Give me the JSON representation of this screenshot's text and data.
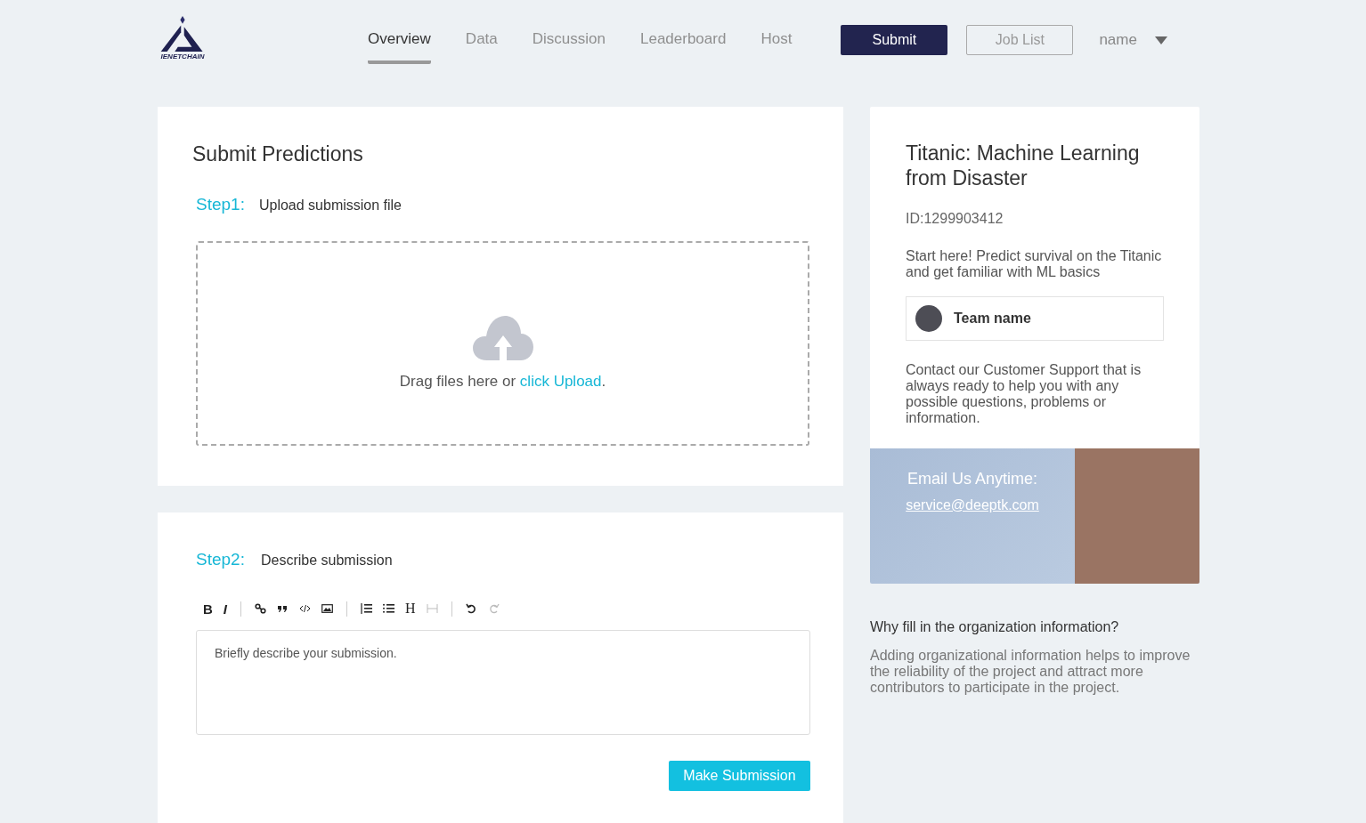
{
  "logo": {
    "text": "IENETCHAIN"
  },
  "tabs": [
    {
      "label": "Overview",
      "selected": true
    },
    {
      "label": "Data",
      "selected": false
    },
    {
      "label": "Discussion",
      "selected": false
    },
    {
      "label": "Leaderboard",
      "selected": false
    },
    {
      "label": "Host",
      "selected": false
    }
  ],
  "header_buttons": {
    "submit": "Submit",
    "job_list": "Job List",
    "user": "name"
  },
  "upload_card": {
    "title": "Submit Predictions",
    "step_label": "Step1:",
    "step_text": "Upload submission file",
    "drop_text": "Drag files here or ",
    "drop_link": "click Upload",
    "drop_end": "."
  },
  "describe_card": {
    "step_label": "Step2:",
    "step_text": "Describe submission",
    "toolbar": [
      [
        {
          "kind": "bold",
          "label": "B",
          "disabled": false
        },
        {
          "kind": "italic",
          "label": "I",
          "disabled": false
        }
      ],
      [
        {
          "kind": "link",
          "disabled": false
        },
        {
          "kind": "quote",
          "disabled": false
        },
        {
          "kind": "code",
          "disabled": false
        },
        {
          "kind": "image",
          "disabled": false
        }
      ],
      [
        {
          "kind": "olist",
          "disabled": false
        },
        {
          "kind": "ulist",
          "disabled": false
        },
        {
          "kind": "heading",
          "label": "H",
          "disabled": false
        },
        {
          "kind": "rule",
          "disabled": true
        }
      ],
      [
        {
          "kind": "undo",
          "disabled": false
        },
        {
          "kind": "redo",
          "disabled": true
        }
      ]
    ],
    "placeholder": "Briefly describe your submission.",
    "button": "Make Submission"
  },
  "info_card": {
    "title": "Titanic: Machine Learning from Disaster",
    "id": "ID:1299903412",
    "description": "Start here! Predict survival on the Titanic and get familiar with ML basics",
    "team": "Team name",
    "contact": "Contact our Customer Support that is always ready to help you with any possible questions, problems or information.",
    "email_heading": "Email Us Anytime:",
    "email": "service@deeptk.com"
  },
  "org_info": {
    "question": "Why fill in the organization information?",
    "answer": "Adding organizational information helps to improve the reliability of the project and attract more contributors to participate in the project."
  }
}
